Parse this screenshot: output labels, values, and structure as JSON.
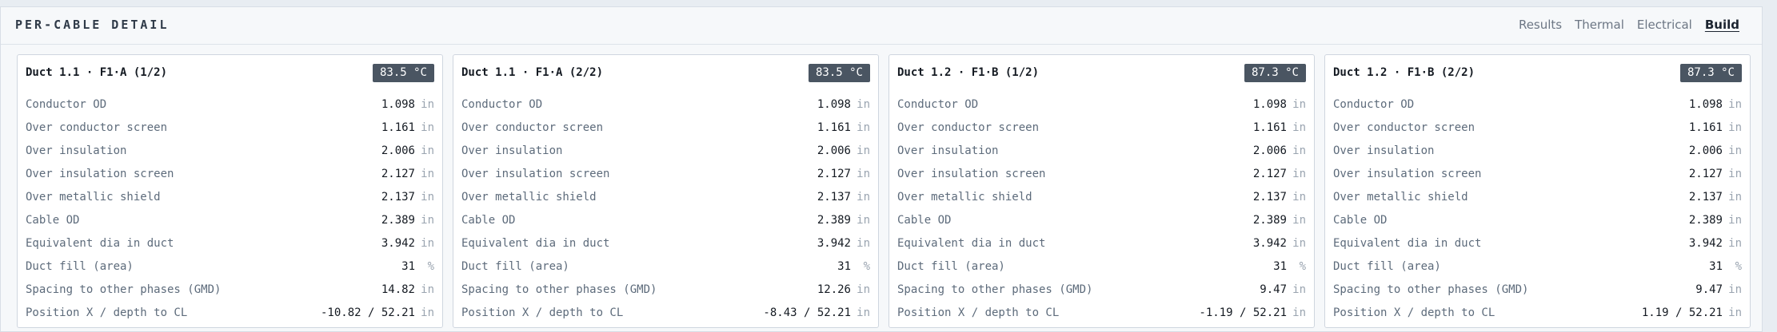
{
  "panel": {
    "title": "PER-CABLE DETAIL",
    "nav": [
      {
        "label": "Results",
        "active": false
      },
      {
        "label": "Thermal",
        "active": false
      },
      {
        "label": "Electrical",
        "active": false
      },
      {
        "label": "Build",
        "active": true
      }
    ]
  },
  "row_labels": [
    "Conductor OD",
    "Over conductor screen",
    "Over insulation",
    "Over insulation screen",
    "Over metallic shield",
    "Cable OD",
    "Equivalent dia in duct",
    "Duct fill (area)",
    "Spacing to other phases (GMD)",
    "Position X / depth to CL"
  ],
  "row_units": [
    "in",
    "in",
    "in",
    "in",
    "in",
    "in",
    "in",
    "%",
    "in",
    "in"
  ],
  "cards": [
    {
      "title": "Duct 1.1 · F1·A (1/2)",
      "temp": "83.5 °C",
      "values": [
        "1.098",
        "1.161",
        "2.006",
        "2.127",
        "2.137",
        "2.389",
        "3.942",
        "31",
        "14.82",
        "-10.82 / 52.21"
      ]
    },
    {
      "title": "Duct 1.1 · F1·A (2/2)",
      "temp": "83.5 °C",
      "values": [
        "1.098",
        "1.161",
        "2.006",
        "2.127",
        "2.137",
        "2.389",
        "3.942",
        "31",
        "12.26",
        "-8.43 / 52.21"
      ]
    },
    {
      "title": "Duct 1.2 · F1·B (1/2)",
      "temp": "87.3 °C",
      "values": [
        "1.098",
        "1.161",
        "2.006",
        "2.127",
        "2.137",
        "2.389",
        "3.942",
        "31",
        "9.47",
        "-1.19 / 52.21"
      ]
    },
    {
      "title": "Duct 1.2 · F1·B (2/2)",
      "temp": "87.3 °C",
      "values": [
        "1.098",
        "1.161",
        "2.006",
        "2.127",
        "2.137",
        "2.389",
        "3.942",
        "31",
        "9.47",
        "1.19 / 52.21"
      ]
    }
  ]
}
